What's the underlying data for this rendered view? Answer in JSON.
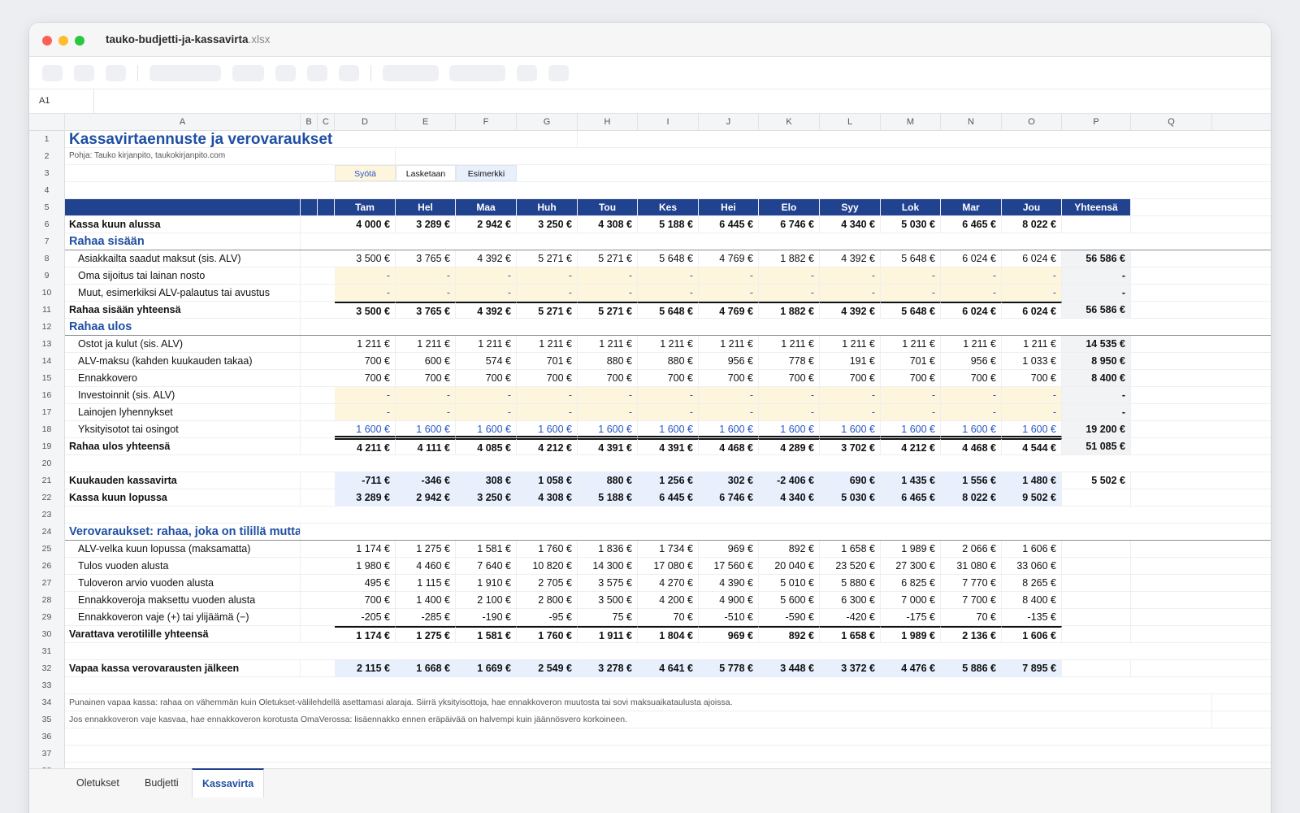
{
  "window": {
    "title": "tauko-budjetti-ja-kassavirta",
    "ext": ".xlsx"
  },
  "formula": {
    "cell": "A1"
  },
  "columns": [
    "A",
    "B",
    "C",
    "D",
    "E",
    "F",
    "G",
    "H",
    "I",
    "J",
    "K",
    "L",
    "M",
    "N",
    "O",
    "P",
    "Q"
  ],
  "title": "Kassavirtaennuste ja verovaraukset",
  "source": "Pohja: Tauko kirjanpito, taukokirjanpito.com",
  "legend": [
    "Syötä",
    "Lasketaan",
    "Esimerkki"
  ],
  "months": [
    "Tam",
    "Hel",
    "Maa",
    "Huh",
    "Tou",
    "Kes",
    "Hei",
    "Elo",
    "Syy",
    "Lok",
    "Mar",
    "Jou"
  ],
  "total_label": "Yhteensä",
  "rows": {
    "r6": {
      "label": "Kassa kuun alussa",
      "values": [
        "4 000 €",
        "3 289 €",
        "2 942 €",
        "3 250 €",
        "4 308 €",
        "5 188 €",
        "6 445 €",
        "6 746 €",
        "4 340 €",
        "5 030 €",
        "6 465 €",
        "8 022 €"
      ],
      "total": ""
    },
    "r7": {
      "label": "Rahaa sisään"
    },
    "r8": {
      "label": "Asiakkailta saadut maksut (sis. ALV)",
      "values": [
        "3 500 €",
        "3 765 €",
        "4 392 €",
        "5 271 €",
        "5 271 €",
        "5 648 €",
        "4 769 €",
        "1 882 €",
        "4 392 €",
        "5 648 €",
        "6 024 €",
        "6 024 €"
      ],
      "total": "56 586 €"
    },
    "r9": {
      "label": "Oma sijoitus tai lainan nosto",
      "values": [
        "-",
        "-",
        "-",
        "-",
        "-",
        "-",
        "-",
        "-",
        "-",
        "-",
        "-",
        "-"
      ],
      "total": "-"
    },
    "r10": {
      "label": "Muut, esimerkiksi ALV-palautus tai avustus",
      "values": [
        "-",
        "-",
        "-",
        "-",
        "-",
        "-",
        "-",
        "-",
        "-",
        "-",
        "-",
        "-"
      ],
      "total": "-"
    },
    "r11": {
      "label": "Rahaa sisään yhteensä",
      "values": [
        "3 500 €",
        "3 765 €",
        "4 392 €",
        "5 271 €",
        "5 271 €",
        "5 648 €",
        "4 769 €",
        "1 882 €",
        "4 392 €",
        "5 648 €",
        "6 024 €",
        "6 024 €"
      ],
      "total": "56 586 €"
    },
    "r12": {
      "label": "Rahaa ulos"
    },
    "r13": {
      "label": "Ostot ja kulut (sis. ALV)",
      "values": [
        "1 211 €",
        "1 211 €",
        "1 211 €",
        "1 211 €",
        "1 211 €",
        "1 211 €",
        "1 211 €",
        "1 211 €",
        "1 211 €",
        "1 211 €",
        "1 211 €",
        "1 211 €"
      ],
      "total": "14 535 €"
    },
    "r14": {
      "label": "ALV-maksu (kahden kuukauden takaa)",
      "values": [
        "700 €",
        "600 €",
        "574 €",
        "701 €",
        "880 €",
        "880 €",
        "956 €",
        "778 €",
        "191 €",
        "701 €",
        "956 €",
        "1 033 €"
      ],
      "total": "8 950 €"
    },
    "r15": {
      "label": "Ennakkovero",
      "values": [
        "700 €",
        "700 €",
        "700 €",
        "700 €",
        "700 €",
        "700 €",
        "700 €",
        "700 €",
        "700 €",
        "700 €",
        "700 €",
        "700 €"
      ],
      "total": "8 400 €"
    },
    "r16": {
      "label": "Investoinnit (sis. ALV)",
      "values": [
        "-",
        "-",
        "-",
        "-",
        "-",
        "-",
        "-",
        "-",
        "-",
        "-",
        "-",
        "-"
      ],
      "total": "-"
    },
    "r17": {
      "label": "Lainojen lyhennykset",
      "values": [
        "-",
        "-",
        "-",
        "-",
        "-",
        "-",
        "-",
        "-",
        "-",
        "-",
        "-",
        "-"
      ],
      "total": "-"
    },
    "r18": {
      "label": "Yksityisotot tai osingot",
      "values": [
        "1 600 €",
        "1 600 €",
        "1 600 €",
        "1 600 €",
        "1 600 €",
        "1 600 €",
        "1 600 €",
        "1 600 €",
        "1 600 €",
        "1 600 €",
        "1 600 €",
        "1 600 €"
      ],
      "total": "19 200 €"
    },
    "r19": {
      "label": "Rahaa ulos yhteensä",
      "values": [
        "4 211 €",
        "4 111 €",
        "4 085 €",
        "4 212 €",
        "4 391 €",
        "4 391 €",
        "4 468 €",
        "4 289 €",
        "3 702 €",
        "4 212 €",
        "4 468 €",
        "4 544 €"
      ],
      "total": "51 085 €"
    },
    "r21": {
      "label": "Kuukauden kassavirta",
      "values": [
        "-711 €",
        "-346 €",
        "308 €",
        "1 058 €",
        "880 €",
        "1 256 €",
        "302 €",
        "-2 406 €",
        "690 €",
        "1 435 €",
        "1 556 €",
        "1 480 €"
      ],
      "total": "5 502 €"
    },
    "r22": {
      "label": "Kassa kuun lopussa",
      "values": [
        "3 289 €",
        "2 942 €",
        "3 250 €",
        "4 308 €",
        "5 188 €",
        "6 445 €",
        "6 746 €",
        "4 340 €",
        "5 030 €",
        "6 465 €",
        "8 022 €",
        "9 502 €"
      ],
      "total": ""
    },
    "r24": {
      "label": "Verovaraukset: rahaa, joka on tilillä mutta e"
    },
    "r25": {
      "label": "ALV-velka kuun lopussa (maksamatta)",
      "values": [
        "1 174 €",
        "1 275 €",
        "1 581 €",
        "1 760 €",
        "1 836 €",
        "1 734 €",
        "969 €",
        "892 €",
        "1 658 €",
        "1 989 €",
        "2 066 €",
        "1 606 €"
      ],
      "total": ""
    },
    "r26": {
      "label": "Tulos vuoden alusta",
      "values": [
        "1 980 €",
        "4 460 €",
        "7 640 €",
        "10 820 €",
        "14 300 €",
        "17 080 €",
        "17 560 €",
        "20 040 €",
        "23 520 €",
        "27 300 €",
        "31 080 €",
        "33 060 €"
      ],
      "total": ""
    },
    "r27": {
      "label": "Tuloveron arvio vuoden alusta",
      "values": [
        "495 €",
        "1 115 €",
        "1 910 €",
        "2 705 €",
        "3 575 €",
        "4 270 €",
        "4 390 €",
        "5 010 €",
        "5 880 €",
        "6 825 €",
        "7 770 €",
        "8 265 €"
      ],
      "total": ""
    },
    "r28": {
      "label": "Ennakkoveroja maksettu vuoden alusta",
      "values": [
        "700 €",
        "1 400 €",
        "2 100 €",
        "2 800 €",
        "3 500 €",
        "4 200 €",
        "4 900 €",
        "5 600 €",
        "6 300 €",
        "7 000 €",
        "7 700 €",
        "8 400 €"
      ],
      "total": ""
    },
    "r29": {
      "label": "Ennakkoveron vaje (+) tai ylijäämä (−)",
      "values": [
        "-205 €",
        "-285 €",
        "-190 €",
        "-95 €",
        "75 €",
        "70 €",
        "-510 €",
        "-590 €",
        "-420 €",
        "-175 €",
        "70 €",
        "-135 €"
      ],
      "total": ""
    },
    "r30": {
      "label": "Varattava verotilille yhteensä",
      "values": [
        "1 174 €",
        "1 275 €",
        "1 581 €",
        "1 760 €",
        "1 911 €",
        "1 804 €",
        "969 €",
        "892 €",
        "1 658 €",
        "1 989 €",
        "2 136 €",
        "1 606 €"
      ],
      "total": ""
    },
    "r32": {
      "label": "Vapaa kassa verovarausten jälkeen",
      "values": [
        "2 115 €",
        "1 668 €",
        "1 669 €",
        "2 549 €",
        "3 278 €",
        "4 641 €",
        "5 778 €",
        "3 448 €",
        "3 372 €",
        "4 476 €",
        "5 886 €",
        "7 895 €"
      ],
      "total": ""
    }
  },
  "notes": [
    "Punainen vapaa kassa: rahaa on vähemmän kuin Oletukset-välilehdellä asettamasi alaraja. Siirrä yksityisottoja, hae ennakkoveron muutosta tai sovi maksuaikataulusta ajoissa.",
    "Jos ennakkoveron vaje kasvaa, hae ennakkoveron korotusta OmaVerossa: lisäennakko ennen eräpäivää on halvempi kuin jäännösvero korkoineen."
  ],
  "tabs": [
    "Oletukset",
    "Budjetti",
    "Kassavirta"
  ],
  "colors": {
    "header": "#21428f",
    "section": "#1f4fa3",
    "input": "#fef6dc",
    "calc": "#e8effd"
  }
}
